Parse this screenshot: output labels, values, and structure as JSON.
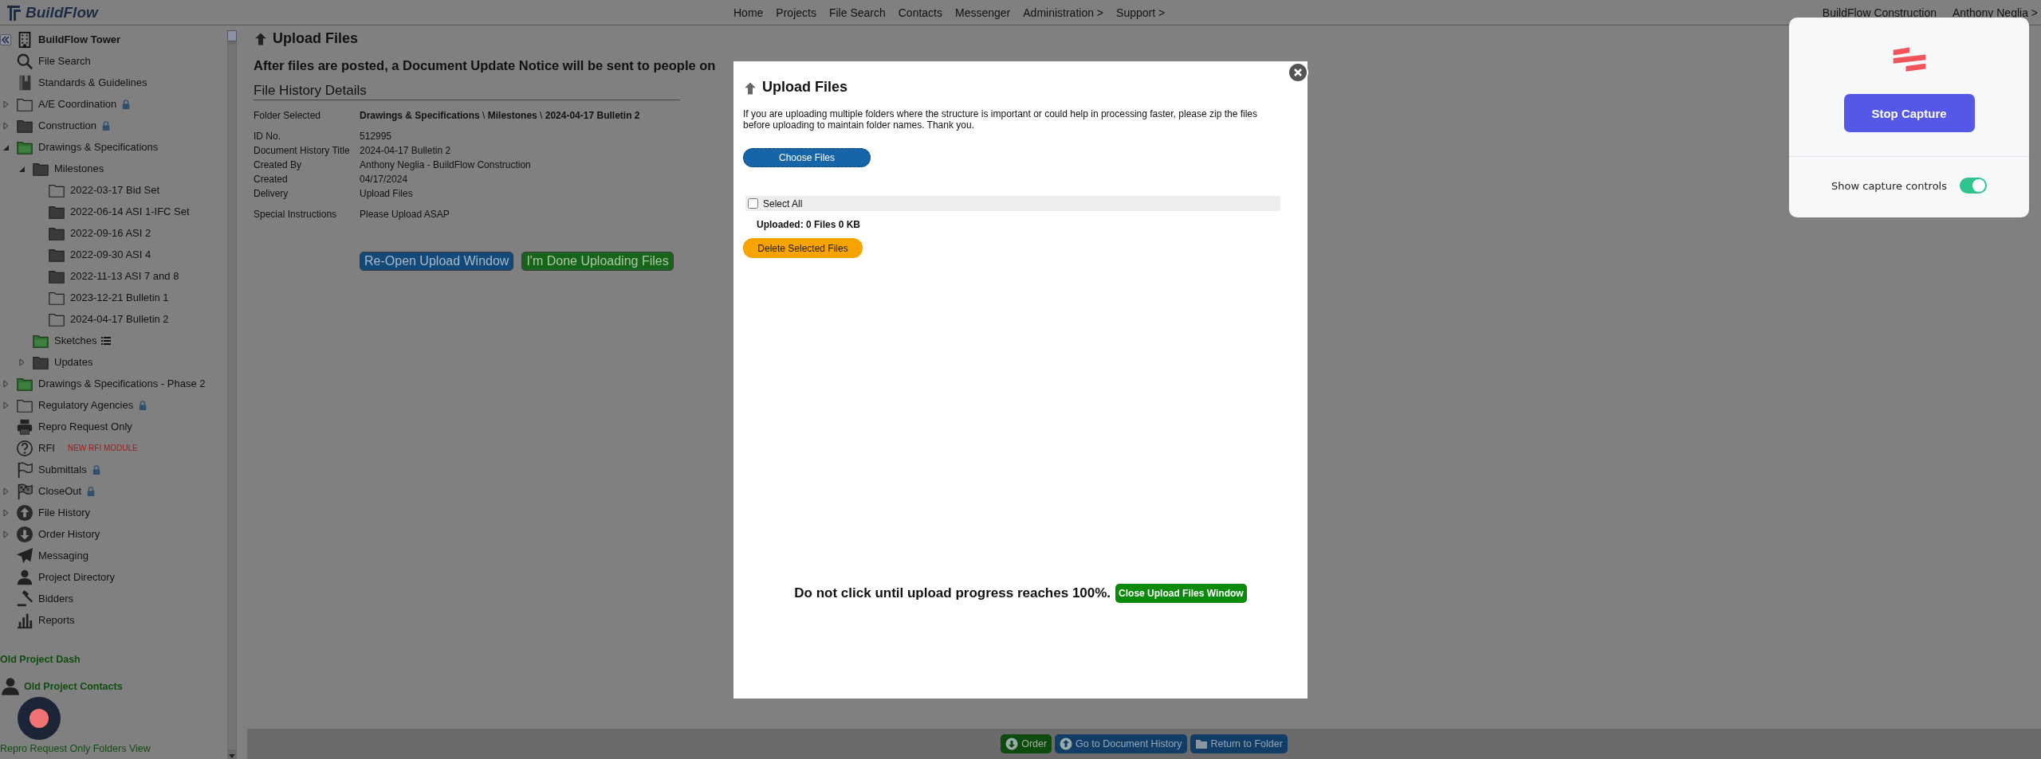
{
  "nav": {
    "logo": "BuildFlow",
    "links": [
      "Home",
      "Projects",
      "File Search",
      "Contacts",
      "Messenger",
      "Administration >",
      "Support >"
    ],
    "company": "BuildFlow Construction",
    "user": "Anthony Neglia >"
  },
  "sidebar": {
    "project": "BuildFlow Tower",
    "items": [
      {
        "label": "File Search",
        "kind": "search"
      },
      {
        "label": "Standards & Guidelines",
        "kind": "book"
      },
      {
        "label": "A/E Coordination",
        "kind": "folder",
        "expanded": false,
        "locked": true
      },
      {
        "label": "Construction",
        "kind": "darkfolder",
        "expanded": false,
        "locked": true
      },
      {
        "label": "Drawings & Specifications",
        "kind": "greenfolder",
        "expanded": true,
        "children": [
          {
            "label": "Milestones",
            "kind": "darkfolder",
            "expanded": true,
            "children": [
              {
                "label": "2022-03-17 Bid Set",
                "kind": "folder"
              },
              {
                "label": "2022-06-14 ASI 1-IFC Set",
                "kind": "darkfolder"
              },
              {
                "label": "2022-09-16 ASI 2",
                "kind": "darkfolder"
              },
              {
                "label": "2022-09-30 ASI 4",
                "kind": "darkfolder"
              },
              {
                "label": "2022-11-13 ASI 7 and 8",
                "kind": "darkfolder"
              },
              {
                "label": "2023-12-21 Bulletin 1",
                "kind": "folder"
              },
              {
                "label": "2024-04-17 Bulletin 2",
                "kind": "folder"
              }
            ]
          },
          {
            "label": "Sketches",
            "kind": "greenfolder",
            "list_view": true
          },
          {
            "label": "Updates",
            "kind": "darkfolder",
            "expanded": false
          }
        ]
      },
      {
        "label": "Drawings & Specifications - Phase 2",
        "kind": "greenfolder",
        "expanded": false
      },
      {
        "label": "Regulatory Agencies",
        "kind": "folder",
        "expanded": false,
        "locked": true
      },
      {
        "label": "Repro Request Only",
        "kind": "printer"
      },
      {
        "label": "RFI",
        "kind": "help",
        "badge": "NEW RFI MODULE"
      },
      {
        "label": "Submittals",
        "kind": "flag",
        "locked": true
      },
      {
        "label": "CloseOut",
        "kind": "finish",
        "expanded": false,
        "locked": true
      },
      {
        "label": "File History",
        "kind": "upload",
        "expanded": false
      },
      {
        "label": "Order History",
        "kind": "download",
        "expanded": false
      },
      {
        "label": "Messaging",
        "kind": "send"
      },
      {
        "label": "Project Directory",
        "kind": "person"
      },
      {
        "label": "Bidders",
        "kind": "gavel"
      },
      {
        "label": "Reports",
        "kind": "chart"
      }
    ],
    "footer_links": [
      {
        "label": "Old Project Dash",
        "kind": "text"
      },
      {
        "label": "Old Project Contacts",
        "kind": "person"
      },
      {
        "label": "Repro Request Only Folders View",
        "kind": "text"
      }
    ]
  },
  "page": {
    "title": "Upload Files",
    "notice": "After files are posted, a Document Update Notice will be sent to people on",
    "section_title": "File History Details",
    "detail_groups": [
      [
        {
          "label": "Folder Selected",
          "value": "**Drawings & Specifications** \\ **Milestones** \\ **2024-04-17 Bulletin 2**"
        }
      ],
      [
        {
          "label": "ID No.",
          "value": "512995"
        },
        {
          "label": "Document History Title",
          "value": "2024-04-17 Bulletin 2"
        },
        {
          "label": "Created By",
          "value": "Anthony Neglia - BuildFlow Construction"
        },
        {
          "label": "Created",
          "value": "04/17/2024"
        },
        {
          "label": "Delivery",
          "value": "Upload Files"
        }
      ],
      [
        {
          "label": "Special Instructions",
          "value": "Please Upload ASAP"
        }
      ]
    ],
    "buttons": [
      {
        "label": "Re-Open Upload Window",
        "kind": "primary"
      },
      {
        "label": "I'm Done Uploading Files",
        "kind": "success"
      }
    ]
  },
  "modal": {
    "title": "Upload Files",
    "message": "If you are uploading multiple folders where the structure is important or could help in processing faster, please zip the files before uploading to maintain folder names. Thank you.",
    "choose_button": "Choose Files",
    "select_all": {
      "label": "Select All",
      "checked": false
    },
    "uploaded": "Uploaded: 0 Files 0 KB",
    "delete_button": "Delete Selected Files",
    "warning": "Do not click until upload progress reaches 100%.",
    "close_button": "Close Upload Files Window"
  },
  "capture": {
    "stop_button": "Stop Capture",
    "show_controls_label": "Show capture controls",
    "show_controls": true
  },
  "bottom_bar": {
    "buttons": [
      {
        "label": "Order",
        "kind": "download"
      },
      {
        "label": "Go to Document History",
        "kind": "upload"
      },
      {
        "label": "Return to Folder",
        "kind": "folder"
      }
    ]
  }
}
